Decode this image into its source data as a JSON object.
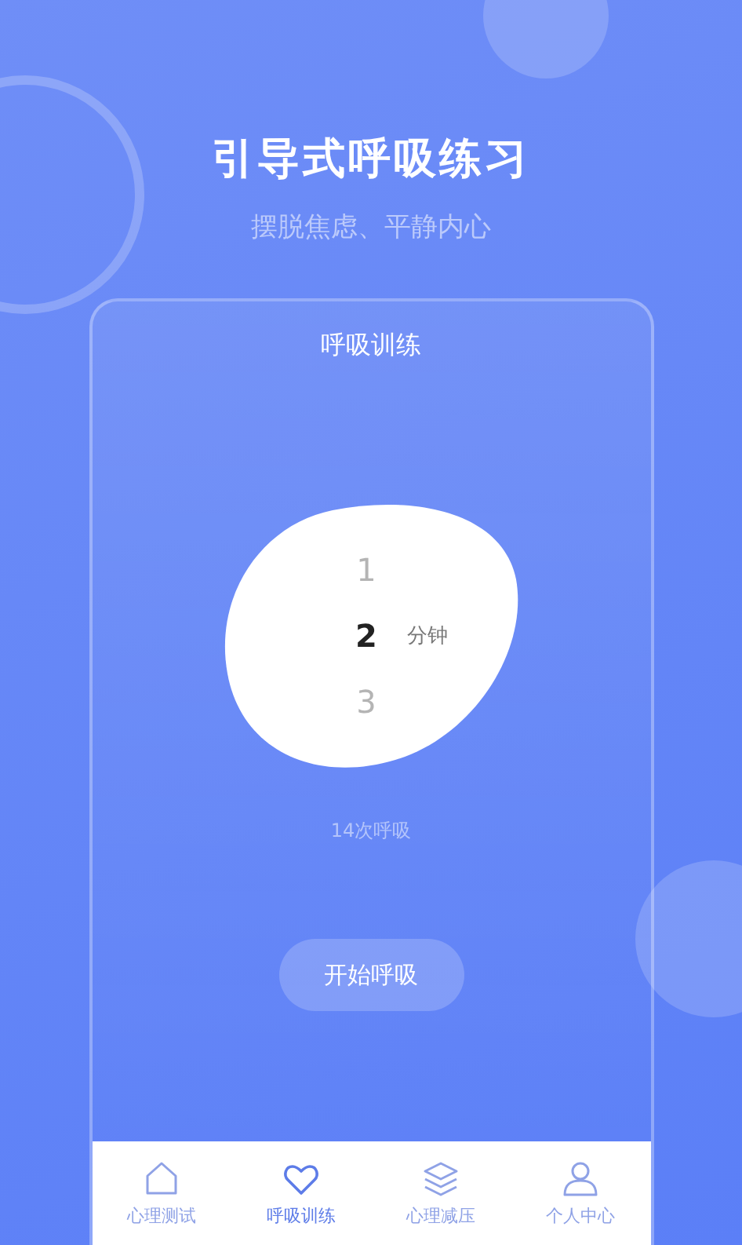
{
  "header": {
    "title": "引导式呼吸练习",
    "subtitle": "摆脱焦虑、平静内心"
  },
  "card": {
    "title": "呼吸训练",
    "picker": {
      "options": [
        {
          "label": "1",
          "selected": false
        },
        {
          "label": "2",
          "selected": true
        },
        {
          "label": "3",
          "selected": false
        }
      ],
      "unit": "分钟"
    },
    "breaths": "14次呼吸",
    "start_button": "开始呼吸"
  },
  "tabs": [
    {
      "label": "心理测试",
      "kind": "home",
      "selected": false
    },
    {
      "label": "呼吸训练",
      "kind": "heart",
      "selected": true
    },
    {
      "label": "心理减压",
      "kind": "layers",
      "selected": false
    },
    {
      "label": "个人中心",
      "kind": "person",
      "selected": false
    }
  ]
}
